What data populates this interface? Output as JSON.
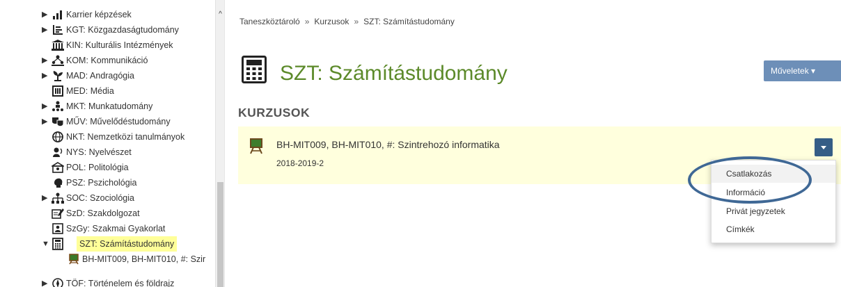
{
  "sidebar": {
    "items": [
      {
        "label": "Karrier képzések",
        "icon": "bar-chart-icon",
        "expandable": true
      },
      {
        "label": "KGT: Közgazdaságtudomány",
        "icon": "list-chart-icon",
        "expandable": true
      },
      {
        "label": "KIN: Kulturális Intézmények",
        "icon": "institution-icon",
        "expandable": false
      },
      {
        "label": "KOM: Kommunikáció",
        "icon": "people-network-icon",
        "expandable": true
      },
      {
        "label": "MAD: Andragógia",
        "icon": "plant-icon",
        "expandable": true
      },
      {
        "label": "MED: Média",
        "icon": "media-icon",
        "expandable": false
      },
      {
        "label": "MKT: Munkatudomány",
        "icon": "workers-icon",
        "expandable": true
      },
      {
        "label": "MŰV: Művelődéstudomány",
        "icon": "theater-masks-icon",
        "expandable": true
      },
      {
        "label": "NKT: Nemzetközi tanulmányok",
        "icon": "globe-icon",
        "expandable": false
      },
      {
        "label": "NYS: Nyelvészet",
        "icon": "speaker-icon",
        "expandable": false
      },
      {
        "label": "POL: Politológia",
        "icon": "parliament-icon",
        "expandable": false
      },
      {
        "label": "PSZ: Pszichológia",
        "icon": "head-icon",
        "expandable": false
      },
      {
        "label": "SOC: Szociológia",
        "icon": "hierarchy-icon",
        "expandable": true
      },
      {
        "label": "SzD: Szakdolgozat",
        "icon": "edit-document-icon",
        "expandable": false
      },
      {
        "label": "SzGy: Szakmai Gyakorlat",
        "icon": "id-card-icon",
        "expandable": false
      },
      {
        "label": "SZT: Számítástudomány",
        "icon": "calculator-icon",
        "expandable": true,
        "expanded": true,
        "selected": true
      },
      {
        "label": "BH-MIT009, BH-MIT010, #: Szir",
        "icon": "blackboard-icon",
        "expandable": false,
        "child": true
      },
      {
        "label": "TÖF: Történelem és földrajz",
        "icon": "compass-icon",
        "expandable": true
      }
    ]
  },
  "breadcrumb": {
    "items": [
      "Taneszköztároló",
      "Kurzusok",
      "SZT: Számítástudomány"
    ],
    "separator": "»"
  },
  "page": {
    "title": "SZT: Számítástudomány",
    "title_icon": "calculator-icon",
    "actions_label": "Műveletek ▾",
    "title_color": "#5c8a2a"
  },
  "courses": {
    "heading": "KURZUSOK",
    "items": [
      {
        "name": "BH-MIT009, BH-MIT010, #: Szintrehozó informatika",
        "term": "2018-2019-2",
        "icon": "blackboard-icon"
      }
    ]
  },
  "dropdown": {
    "items": [
      "Csatlakozás",
      "Információ",
      "Privát jegyzetek",
      "Címkék"
    ],
    "hovered_index": 0
  },
  "colors": {
    "accent_button": "#6d8fb8",
    "row_menu_button": "#355d86",
    "row_background": "#ffffdd",
    "selected_highlight": "#ffff99",
    "annotation_oval": "#3f6895"
  }
}
